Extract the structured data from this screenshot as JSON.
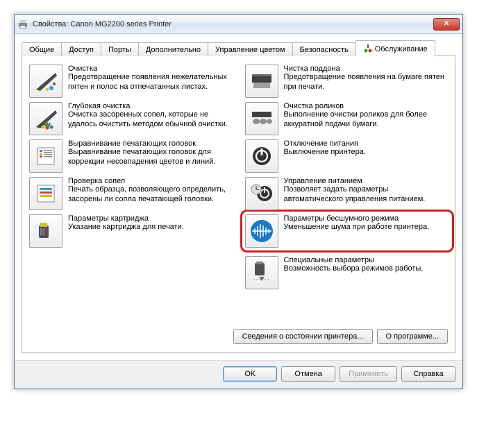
{
  "window": {
    "title": "Свойства: Canon MG2200 series Printer"
  },
  "tabs": {
    "t0": "Общие",
    "t1": "Доступ",
    "t2": "Порты",
    "t3": "Дополнительно",
    "t4": "Управление цветом",
    "t5": "Безопасность",
    "t6": "Обслуживание"
  },
  "left": [
    {
      "title": "Очистка",
      "desc": "Предотвращение появления нежелательных пятен и полос на отпечатанных листах."
    },
    {
      "title": "Глубокая очистка",
      "desc": "Очистка засоренных сопел, которые не удалось очистить методом обычной очистки."
    },
    {
      "title": "Выравнивание печатающих головок",
      "desc": "Выравнивание печатающих головок для коррекции несовпадения цветов и линий."
    },
    {
      "title": "Проверка сопел",
      "desc": "Печать образца, позволяющего определить, засорены ли сопла печатающей головки."
    },
    {
      "title": "Параметры картриджа",
      "desc": "Указание картриджа для печати."
    }
  ],
  "right": [
    {
      "title": "Чистка поддона",
      "desc": "Предотвращение появления на бумаге пятен при печати."
    },
    {
      "title": "Очистка роликов",
      "desc": "Выполнение очистки роликов для более аккуратной подачи бумаги."
    },
    {
      "title": "Отключение питания",
      "desc": "Выключение принтера."
    },
    {
      "title": "Управление питанием",
      "desc": "Позволяет задать параметры автоматического управления питанием."
    },
    {
      "title": "Параметры бесшумного режима",
      "desc": "Уменьшение шума при работе принтера."
    },
    {
      "title": "Специальные параметры",
      "desc": "Возможность выбора режимов работы."
    }
  ],
  "panel_buttons": {
    "status": "Сведения о состоянии принтера...",
    "about": "О программе..."
  },
  "footer": {
    "ok": "OK",
    "cancel": "Отмена",
    "apply": "Применить",
    "help": "Справка"
  }
}
